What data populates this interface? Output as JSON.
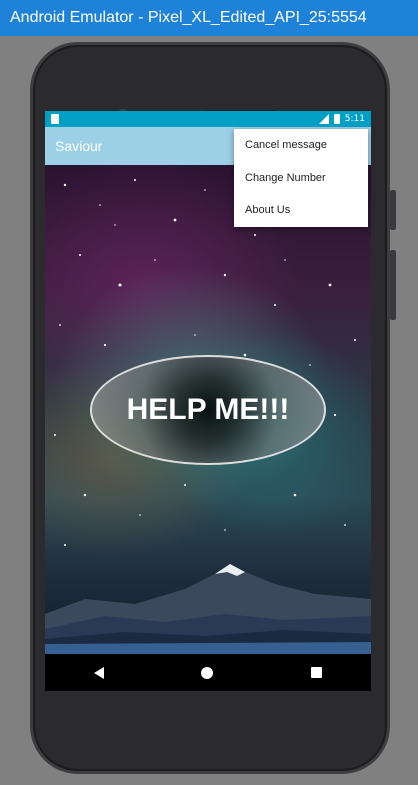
{
  "window": {
    "title": "Android Emulator - Pixel_XL_Edited_API_25:5554"
  },
  "status_bar": {
    "time": "5:11"
  },
  "app_bar": {
    "title": "Saviour"
  },
  "main": {
    "help_button_label": "HELP ME!!!"
  },
  "overflow_menu": {
    "items": [
      {
        "label": "Cancel message"
      },
      {
        "label": "Change Number"
      },
      {
        "label": "About Us"
      }
    ]
  },
  "colors": {
    "title_bar": "#1e82d8",
    "status_bar": "#00a0c6",
    "app_bar": "#9bd0e6"
  }
}
